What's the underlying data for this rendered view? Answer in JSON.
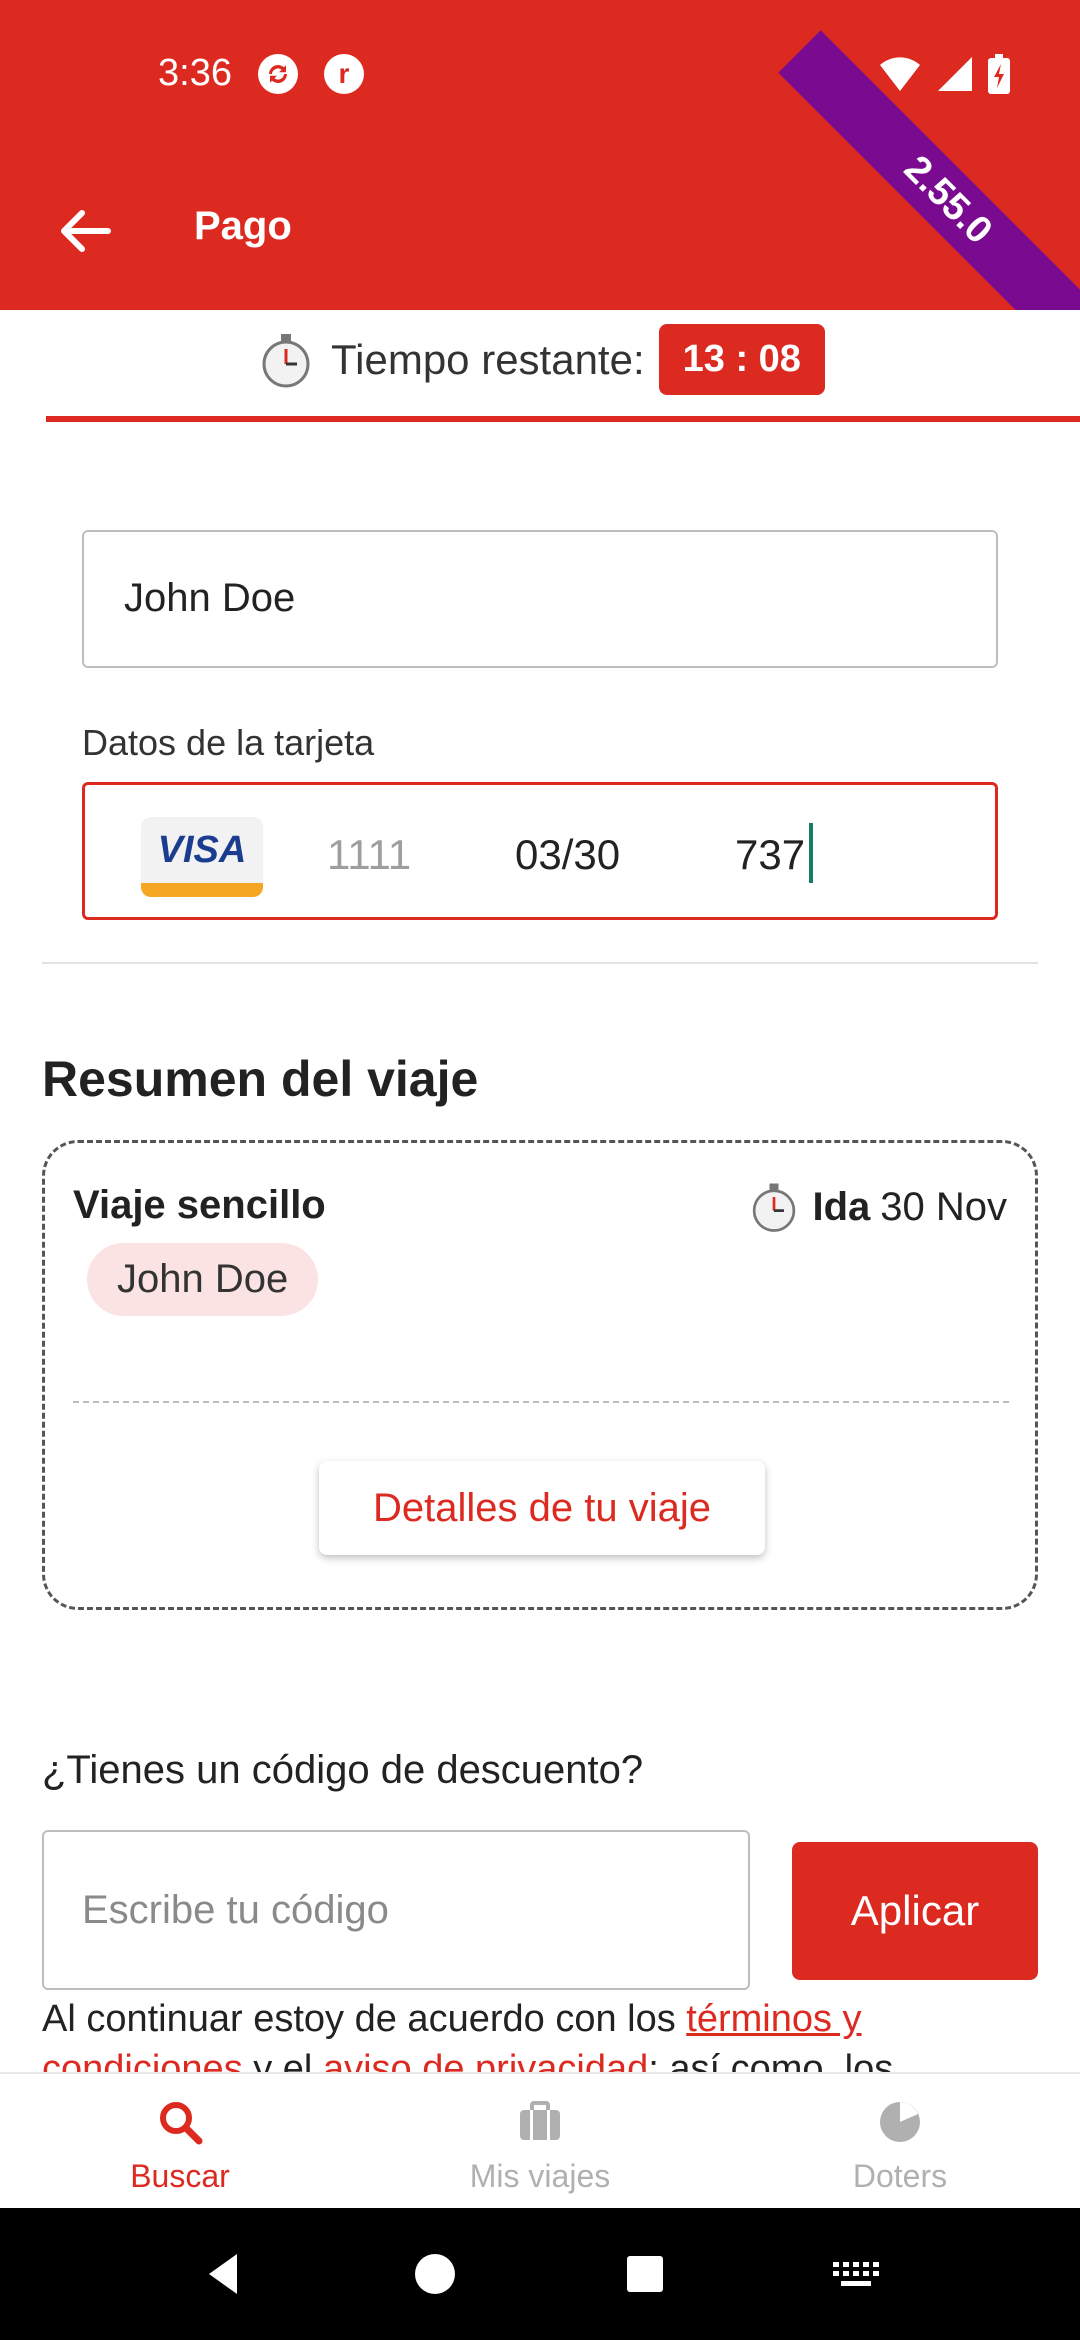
{
  "status_bar": {
    "time": "3:36",
    "app_icons": [
      "sync-icon",
      "r-app-icon"
    ],
    "system_icons": [
      "wifi-icon",
      "signal-icon",
      "battery-charging-icon"
    ],
    "r_icon_letter": "r"
  },
  "app_bar": {
    "title": "Pago",
    "version": "2.55.0",
    "back_icon": "arrow-left-icon"
  },
  "timer": {
    "label": "Tiempo restante:",
    "value": "13 : 08",
    "icon": "stopwatch-icon"
  },
  "form": {
    "name_value": "John Doe",
    "card_label": "Datos de la tarjeta",
    "card_brand": "VISA",
    "card_number": "1111",
    "card_expiry": "03/30",
    "card_cvv": "737"
  },
  "summary": {
    "title": "Resumen del viaje",
    "trip_type": "Viaje sencillo",
    "direction": "Ida",
    "date": "30 Nov",
    "passenger": "John Doe",
    "details_button": "Detalles de tu viaje"
  },
  "discount": {
    "question": "¿Tienes un código de descuento?",
    "placeholder": "Escribe tu código",
    "apply_button": "Aplicar"
  },
  "legal": {
    "text_before": "Al continuar estoy de acuerdo con los ",
    "terms_link": "términos y condiciones",
    "middle": " y el ",
    "privacy_link": "aviso de privacidad",
    "text_after": "; así como, los"
  },
  "bottom_nav": {
    "items": [
      {
        "label": "Buscar",
        "icon": "search-icon",
        "active": true
      },
      {
        "label": "Mis viajes",
        "icon": "briefcase-icon",
        "active": false
      },
      {
        "label": "Doters",
        "icon": "doters-icon",
        "active": false
      }
    ]
  },
  "colors": {
    "primary": "#dc2a21",
    "ribbon": "#7a0a8f",
    "chip_bg": "#fbe3e3",
    "nav_inactive": "#b0b0b0"
  }
}
